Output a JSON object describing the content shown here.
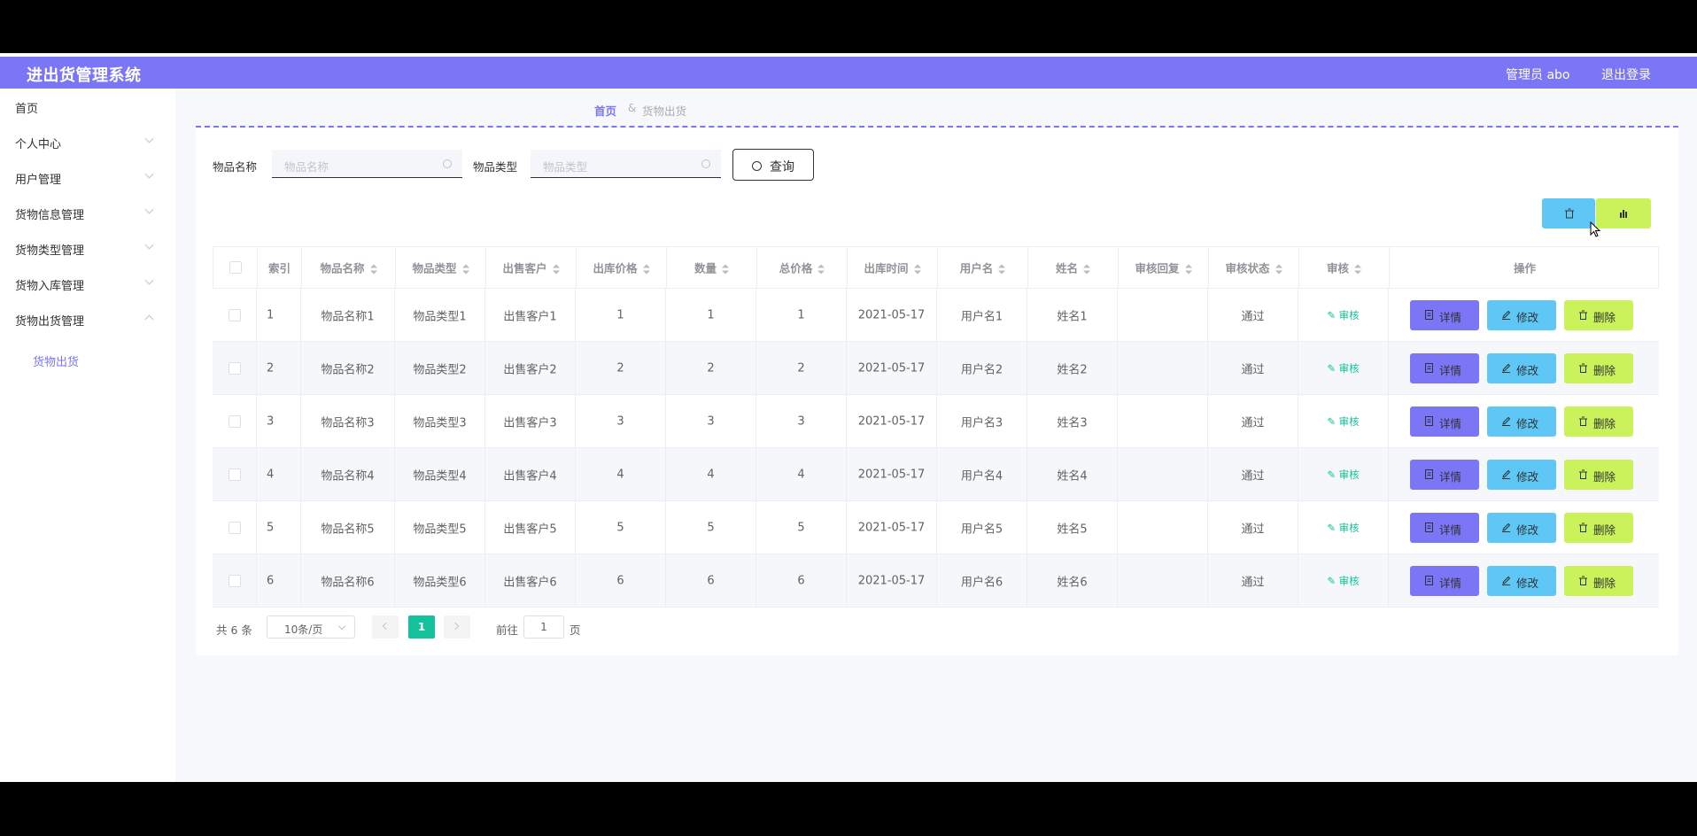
{
  "header": {
    "app_title": "进出货管理系统",
    "user_label": "管理员 abo",
    "logout_label": "退出登录"
  },
  "sidebar": {
    "items": [
      {
        "label": "首页"
      },
      {
        "label": "个人中心"
      },
      {
        "label": "用户管理"
      },
      {
        "label": "货物信息管理"
      },
      {
        "label": "货物类型管理"
      },
      {
        "label": "货物入库管理"
      },
      {
        "label": "货物出货管理",
        "expanded": true
      }
    ],
    "subitems": [
      {
        "label": "货物出货",
        "active": true
      }
    ]
  },
  "breadcrumb": {
    "home": "首页",
    "separator": "&",
    "current": "货物出货"
  },
  "filters": {
    "name_label": "物品名称",
    "name_placeholder": "物品名称",
    "type_label": "物品类型",
    "type_placeholder": "物品类型",
    "query_button": "查询"
  },
  "toolbar": {
    "delete_icon": "trash-icon",
    "chart_icon": "bar-chart-icon"
  },
  "table": {
    "columns": [
      "",
      "索引",
      "物品名称",
      "物品类型",
      "出售客户",
      "出库价格",
      "数量",
      "总价格",
      "出库时间",
      "用户名",
      "姓名",
      "审核回复",
      "审核状态",
      "审核",
      "操作"
    ],
    "rows": [
      {
        "index": "1",
        "name": "物品名称1",
        "type": "物品类型1",
        "customer": "出售客户1",
        "price": "1",
        "qty": "1",
        "total": "1",
        "time": "2021-05-17",
        "username": "用户名1",
        "realname": "姓名1",
        "reply": "",
        "status": "通过",
        "audit": "审核"
      },
      {
        "index": "2",
        "name": "物品名称2",
        "type": "物品类型2",
        "customer": "出售客户2",
        "price": "2",
        "qty": "2",
        "total": "2",
        "time": "2021-05-17",
        "username": "用户名2",
        "realname": "姓名2",
        "reply": "",
        "status": "通过",
        "audit": "审核"
      },
      {
        "index": "3",
        "name": "物品名称3",
        "type": "物品类型3",
        "customer": "出售客户3",
        "price": "3",
        "qty": "3",
        "total": "3",
        "time": "2021-05-17",
        "username": "用户名3",
        "realname": "姓名3",
        "reply": "",
        "status": "通过",
        "audit": "审核"
      },
      {
        "index": "4",
        "name": "物品名称4",
        "type": "物品类型4",
        "customer": "出售客户4",
        "price": "4",
        "qty": "4",
        "total": "4",
        "time": "2021-05-17",
        "username": "用户名4",
        "realname": "姓名4",
        "reply": "",
        "status": "通过",
        "audit": "审核"
      },
      {
        "index": "5",
        "name": "物品名称5",
        "type": "物品类型5",
        "customer": "出售客户5",
        "price": "5",
        "qty": "5",
        "total": "5",
        "time": "2021-05-17",
        "username": "用户名5",
        "realname": "姓名5",
        "reply": "",
        "status": "通过",
        "audit": "审核"
      },
      {
        "index": "6",
        "name": "物品名称6",
        "type": "物品类型6",
        "customer": "出售客户6",
        "price": "6",
        "qty": "6",
        "total": "6",
        "time": "2021-05-17",
        "username": "用户名6",
        "realname": "姓名6",
        "reply": "",
        "status": "通过",
        "audit": "审核"
      }
    ],
    "actions": {
      "detail": "详情",
      "edit": "修改",
      "delete": "删除"
    }
  },
  "pagination": {
    "total": "共 6 条",
    "page_size": "10条/页",
    "current_page": "1",
    "goto_label": "前往",
    "goto_value": "1",
    "page_suffix": "页"
  },
  "colors": {
    "primary": "#7b76f5",
    "cyan": "#5fc7f5",
    "lime": "#c9f25b",
    "green": "#13c29a"
  }
}
